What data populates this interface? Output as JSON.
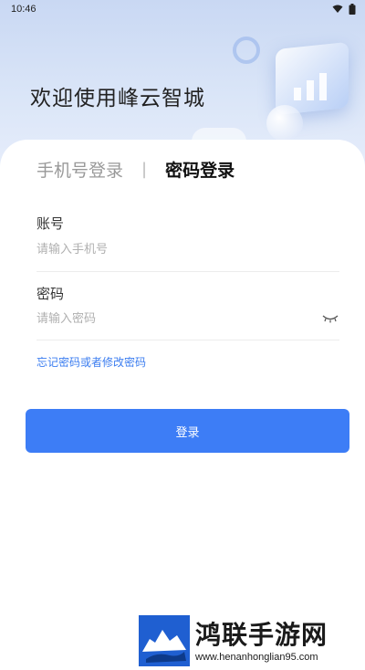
{
  "status_bar": {
    "time": "10:46",
    "wifi_icon": "wifi-icon",
    "battery_icon": "battery-icon"
  },
  "header": {
    "welcome": "欢迎使用峰云智城"
  },
  "tabs": {
    "phone_login": "手机号登录",
    "divider": "|",
    "password_login": "密码登录",
    "active": "password_login"
  },
  "form": {
    "account": {
      "label": "账号",
      "placeholder": "请输入手机号",
      "value": ""
    },
    "password": {
      "label": "密码",
      "placeholder": "请输入密码",
      "value": "",
      "toggle_icon": "eye-closed-icon"
    },
    "forgot_link": "忘记密码或者修改密码",
    "submit": "登录"
  },
  "watermark": {
    "name": "鸿联手游网",
    "url": "www.henanhonglian95.com"
  },
  "colors": {
    "accent": "#3d7df6",
    "link": "#3b7df0",
    "hero_bg": "#d6e2f7"
  }
}
